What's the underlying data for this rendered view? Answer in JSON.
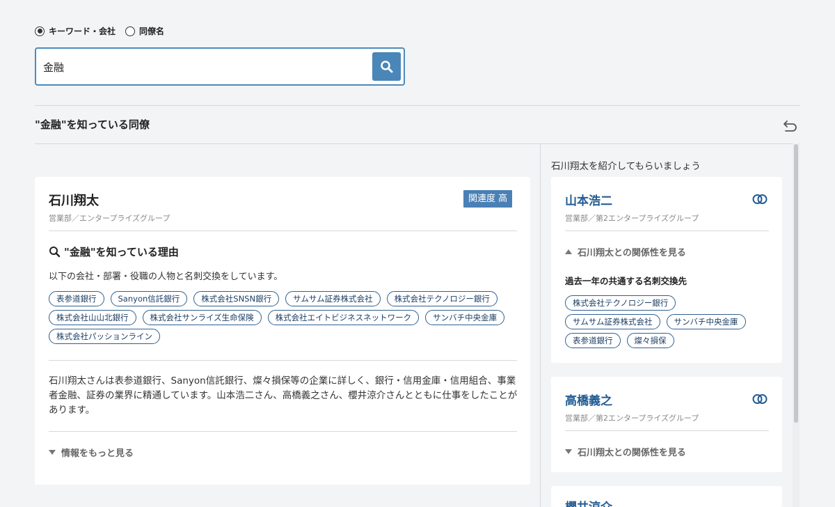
{
  "search": {
    "mode_keyword": "キーワード・会社",
    "mode_colleague": "同僚名",
    "query": "金融"
  },
  "section": {
    "title": "\"金融\"を知っている同僚"
  },
  "main_card": {
    "name": "石川翔太",
    "dept": "営業部／エンタープライズグループ",
    "badge": "関連度 高",
    "reason_title": "\"金融\"を知っている理由",
    "reason_sub": "以下の会社・部署・役職の人物と名刺交換をしています。",
    "tags": [
      "表参道銀行",
      "Sanyon信託銀行",
      "株式会社SNSN銀行",
      "サムサム証券株式会社",
      "株式会社テクノロジー銀行",
      "株式会社山山北銀行",
      "株式会社サンライズ生命保険",
      "株式会社エイトビジネスネットワーク",
      "サンバチ中央金庫",
      "株式会社パッションライン"
    ],
    "description": "石川翔太さんは表参道銀行、Sanyon信託銀行、燦々損保等の企業に詳しく、銀行・信用金庫・信用組合、事業者金融、証券の業界に精通しています。山本浩二さん、高橋義之さん、櫻井涼介さんとともに仕事をしたことがあります。",
    "more_label": "情報をもっと見る"
  },
  "intro": {
    "title": "石川翔太を紹介してもらいましょう",
    "people": [
      {
        "name": "山本浩二",
        "dept": "営業部／第2エンタープライズグループ",
        "relation_label": "石川翔太との関係性を見る",
        "common_title": "過去一年の共通する名刺交換先",
        "tags": [
          "株式会社テクノロジー銀行",
          "サムサム証券株式会社",
          "サンバチ中央金庫",
          "表参道銀行",
          "燦々損保"
        ]
      },
      {
        "name": "高橋義之",
        "dept": "営業部／第2エンタープライズグループ",
        "relation_label": "石川翔太との関係性を見る"
      },
      {
        "name": "櫻井涼介"
      }
    ]
  },
  "icons": {
    "search": "search-icon",
    "back": "undo-arrow-icon",
    "link": "link-rings-icon"
  },
  "colors": {
    "accent": "#4a86b8",
    "name_link": "#235c94",
    "badge": "#4a80b5"
  }
}
